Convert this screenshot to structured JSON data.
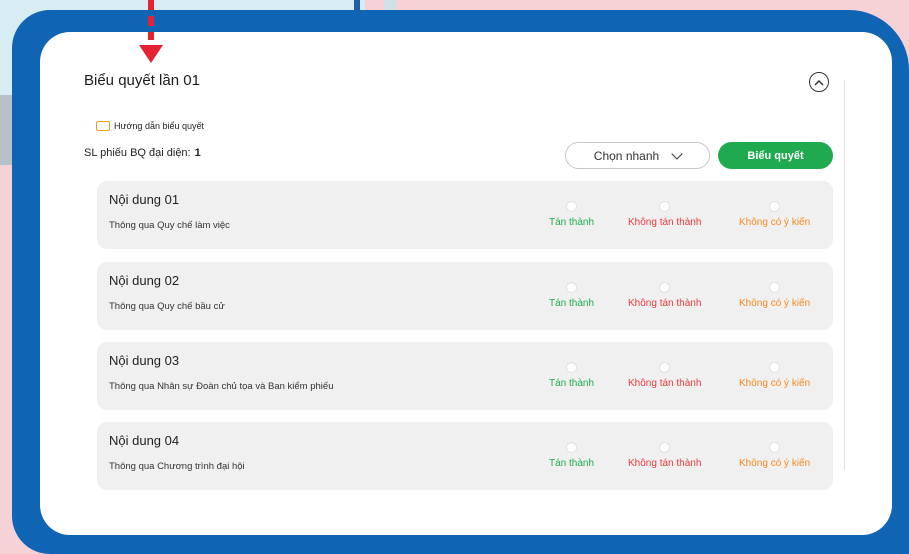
{
  "vote": {
    "title": "Biểu quyết lần 01",
    "guide_label": "Hướng dẫn biểu quyết",
    "count_label": "SL phiếu BQ đại diện:",
    "count_value": "1",
    "quick_select_label": "Chọn nhanh",
    "submit_label": "Biểu quyết",
    "items": [
      {
        "title": "Nội dung 01",
        "description": "Thông qua Quy chế làm việc"
      },
      {
        "title": "Nội dung 02",
        "description": "Thông qua Quy chế bầu cử"
      },
      {
        "title": "Nội dung 03",
        "description": "Thông qua Nhân sự Đoàn chủ tọa và Ban kiểm phiếu"
      },
      {
        "title": "Nội dung 04",
        "description": "Thông qua Chương trình đại hội"
      }
    ],
    "options": {
      "agree": "Tán thành",
      "disagree": "Không tán thành",
      "no_opinion": "Không có ý kiến"
    }
  },
  "icons": {
    "collapse": "chevron-up-icon",
    "guide": "document-icon",
    "quick_select": "chevron-down-icon",
    "annotation": "arrow-down-icon"
  },
  "colors": {
    "frame": "#0f64b3",
    "agree": "#1faa4f",
    "disagree": "#e83a3a",
    "no_opinion": "#f58a1f",
    "annotation": "#e32232"
  }
}
